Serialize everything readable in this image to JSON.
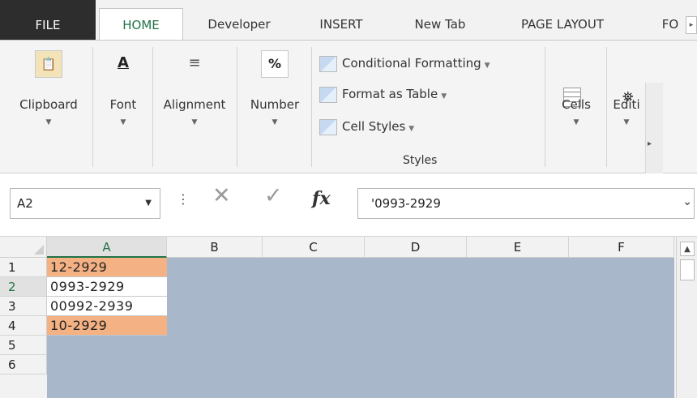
{
  "tabs": {
    "file": "FILE",
    "home": "HOME",
    "developer": "Developer",
    "insert": "INSERT",
    "newtab": "New Tab",
    "pagelayout": "PAGE LAYOUT",
    "formulas_trunc": "FO"
  },
  "ribbon": {
    "clipboard": "Clipboard",
    "font": "Font",
    "alignment": "Alignment",
    "number": "Number",
    "number_glyph": "%",
    "font_glyph": "A",
    "conditional_formatting": "Conditional Formatting",
    "format_as_table": "Format as Table",
    "cell_styles": "Cell Styles",
    "styles_group": "Styles",
    "cells": "Cells",
    "editing_trunc": "Editi"
  },
  "formula_bar": {
    "name_box": "A2",
    "fx": "fx",
    "formula": "'0993-2929"
  },
  "grid": {
    "columns": [
      "A",
      "B",
      "C",
      "D",
      "E",
      "F"
    ],
    "rows": [
      "1",
      "2",
      "3",
      "4",
      "5",
      "6"
    ],
    "cells_a": [
      "12-2929",
      "0993-2929",
      "00992-2939",
      "10-2929",
      "",
      ""
    ],
    "highlight_color": "#f4b183",
    "background_color": "#a8b7c9",
    "accent_color": "#217346"
  }
}
